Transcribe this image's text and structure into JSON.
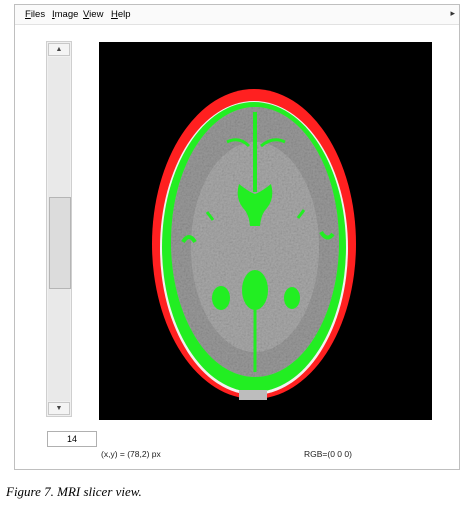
{
  "menu": {
    "files": {
      "hot": "F",
      "rest": "iles"
    },
    "image": {
      "hot": "I",
      "rest": "mage"
    },
    "view": {
      "hot": "V",
      "rest": "iew"
    },
    "help": {
      "hot": "H",
      "rest": "elp"
    },
    "overflow_icon": "chevron-right-icon"
  },
  "scrollbar": {
    "up_icon": "arrow-up-icon",
    "down_icon": "arrow-down-icon"
  },
  "slice_number": "14",
  "status": {
    "coords": "(x,y) = (78,2) px",
    "rgb": "RGB=(0 0 0)"
  },
  "viewer": {
    "background": "#000000",
    "skull_outline_color": "#ff2020",
    "segmentation_color": "#22ee22",
    "tissue_color": "#9a9a9a"
  },
  "caption": "Figure 7. MRI slicer view."
}
